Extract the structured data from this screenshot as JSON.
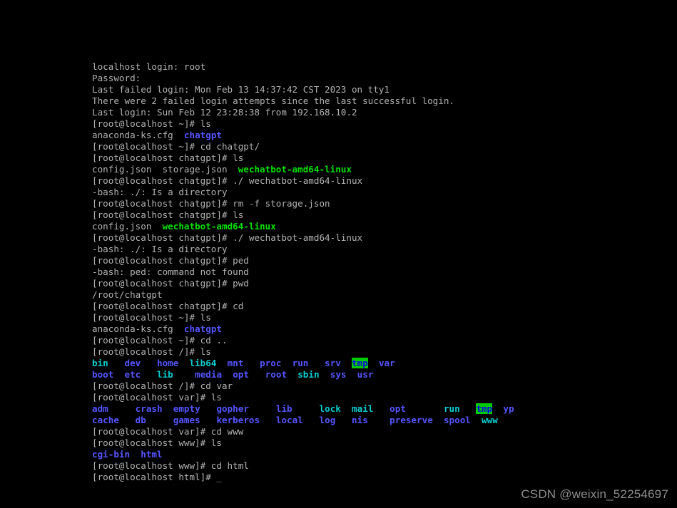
{
  "terminal": {
    "theme": {
      "background": "#000000",
      "foreground": "#b2b2b2",
      "directory": "#5555ff",
      "symlink": "#00cdcd",
      "executable": "#00e000",
      "sticky_bg": "#00cd00",
      "sticky_fg": "#0000ee"
    },
    "hostname": "localhost",
    "user": "root",
    "cursor": "_",
    "lines": [
      {
        "id": "login-prompt",
        "segments": [
          {
            "text": "localhost login: root",
            "style": "default"
          }
        ]
      },
      {
        "id": "password-prompt",
        "segments": [
          {
            "text": "Password:",
            "style": "default"
          }
        ]
      },
      {
        "id": "last-failed-login",
        "segments": [
          {
            "text": "Last failed login: Mon Feb 13 14:37:42 CST 2023 on tty1",
            "style": "default"
          }
        ]
      },
      {
        "id": "failed-attempts",
        "segments": [
          {
            "text": "There were 2 failed login attempts since the last successful login.",
            "style": "default"
          }
        ]
      },
      {
        "id": "last-login",
        "segments": [
          {
            "text": "Last login: Sun Feb 12 23:28:38 from 192.168.10.2",
            "style": "default"
          }
        ]
      },
      {
        "id": "cmd-ls-home",
        "segments": [
          {
            "text": "[root@localhost ~]# ls",
            "style": "default"
          }
        ]
      },
      {
        "id": "out-ls-home",
        "segments": [
          {
            "text": "anaconda-ks.cfg  ",
            "style": "default"
          },
          {
            "text": "chatgpt",
            "style": "dir"
          }
        ]
      },
      {
        "id": "cmd-cd-chatgpt",
        "segments": [
          {
            "text": "[root@localhost ~]# cd chatgpt/",
            "style": "default"
          }
        ]
      },
      {
        "id": "cmd-ls-chatgpt-1",
        "segments": [
          {
            "text": "[root@localhost chatgpt]# ls",
            "style": "default"
          }
        ]
      },
      {
        "id": "out-ls-chatgpt-1",
        "segments": [
          {
            "text": "config.json  storage.json  ",
            "style": "default"
          },
          {
            "text": "wechatbot-amd64-linux",
            "style": "exec"
          }
        ]
      },
      {
        "id": "cmd-run-bot-1",
        "segments": [
          {
            "text": "[root@localhost chatgpt]# ./ wechatbot-amd64-linux",
            "style": "default"
          }
        ]
      },
      {
        "id": "err-isdir-1",
        "segments": [
          {
            "text": "-bash: ./: Is a directory",
            "style": "default"
          }
        ]
      },
      {
        "id": "cmd-rm-storage",
        "segments": [
          {
            "text": "[root@localhost chatgpt]# rm -f storage.json",
            "style": "default"
          }
        ]
      },
      {
        "id": "cmd-ls-chatgpt-2",
        "segments": [
          {
            "text": "[root@localhost chatgpt]# ls",
            "style": "default"
          }
        ]
      },
      {
        "id": "out-ls-chatgpt-2",
        "segments": [
          {
            "text": "config.json  ",
            "style": "default"
          },
          {
            "text": "wechatbot-amd64-linux",
            "style": "exec"
          }
        ]
      },
      {
        "id": "cmd-run-bot-2",
        "segments": [
          {
            "text": "[root@localhost chatgpt]# ./ wechatbot-amd64-linux",
            "style": "default"
          }
        ]
      },
      {
        "id": "err-isdir-2",
        "segments": [
          {
            "text": "-bash: ./: Is a directory",
            "style": "default"
          }
        ]
      },
      {
        "id": "cmd-ped",
        "segments": [
          {
            "text": "[root@localhost chatgpt]# ped",
            "style": "default"
          }
        ]
      },
      {
        "id": "err-ped",
        "segments": [
          {
            "text": "-bash: ped: command not found",
            "style": "default"
          }
        ]
      },
      {
        "id": "cmd-pwd",
        "segments": [
          {
            "text": "[root@localhost chatgpt]# pwd",
            "style": "default"
          }
        ]
      },
      {
        "id": "out-pwd",
        "segments": [
          {
            "text": "/root/chatgpt",
            "style": "default"
          }
        ]
      },
      {
        "id": "cmd-cd-home",
        "segments": [
          {
            "text": "[root@localhost chatgpt]# cd",
            "style": "default"
          }
        ]
      },
      {
        "id": "cmd-ls-home-2",
        "segments": [
          {
            "text": "[root@localhost ~]# ls",
            "style": "default"
          }
        ]
      },
      {
        "id": "out-ls-home-2",
        "segments": [
          {
            "text": "anaconda-ks.cfg  ",
            "style": "default"
          },
          {
            "text": "chatgpt",
            "style": "dir"
          }
        ]
      },
      {
        "id": "cmd-cd-up",
        "segments": [
          {
            "text": "[root@localhost ~]# cd ..",
            "style": "default"
          }
        ]
      },
      {
        "id": "cmd-ls-root",
        "segments": [
          {
            "text": "[root@localhost /]# ls",
            "style": "default"
          }
        ]
      },
      {
        "id": "out-ls-root-1",
        "segments": [
          {
            "text": "bin",
            "style": "link"
          },
          {
            "text": "   ",
            "style": "default"
          },
          {
            "text": "dev",
            "style": "dir"
          },
          {
            "text": "   ",
            "style": "default"
          },
          {
            "text": "home",
            "style": "dir"
          },
          {
            "text": "  ",
            "style": "default"
          },
          {
            "text": "lib64",
            "style": "link"
          },
          {
            "text": "  ",
            "style": "default"
          },
          {
            "text": "mnt",
            "style": "dir"
          },
          {
            "text": "   ",
            "style": "default"
          },
          {
            "text": "proc",
            "style": "dir"
          },
          {
            "text": "  ",
            "style": "default"
          },
          {
            "text": "run",
            "style": "dir"
          },
          {
            "text": "   ",
            "style": "default"
          },
          {
            "text": "srv",
            "style": "dir"
          },
          {
            "text": "  ",
            "style": "default"
          },
          {
            "text": "tmp",
            "style": "sticky"
          },
          {
            "text": "  ",
            "style": "default"
          },
          {
            "text": "var",
            "style": "dir"
          }
        ]
      },
      {
        "id": "out-ls-root-2",
        "segments": [
          {
            "text": "boot",
            "style": "dir"
          },
          {
            "text": "  ",
            "style": "default"
          },
          {
            "text": "etc",
            "style": "dir"
          },
          {
            "text": "   ",
            "style": "default"
          },
          {
            "text": "lib",
            "style": "link"
          },
          {
            "text": "    ",
            "style": "default"
          },
          {
            "text": "media",
            "style": "dir"
          },
          {
            "text": "  ",
            "style": "default"
          },
          {
            "text": "opt",
            "style": "dir"
          },
          {
            "text": "   ",
            "style": "default"
          },
          {
            "text": "root",
            "style": "dir"
          },
          {
            "text": "  ",
            "style": "default"
          },
          {
            "text": "sbin",
            "style": "link"
          },
          {
            "text": "  ",
            "style": "default"
          },
          {
            "text": "sys",
            "style": "dir"
          },
          {
            "text": "  ",
            "style": "default"
          },
          {
            "text": "usr",
            "style": "dir"
          }
        ]
      },
      {
        "id": "cmd-cd-var",
        "segments": [
          {
            "text": "[root@localhost /]# cd var",
            "style": "default"
          }
        ]
      },
      {
        "id": "cmd-ls-var",
        "segments": [
          {
            "text": "[root@localhost var]# ls",
            "style": "default"
          }
        ]
      },
      {
        "id": "out-ls-var-1",
        "segments": [
          {
            "text": "adm",
            "style": "dir"
          },
          {
            "text": "     ",
            "style": "default"
          },
          {
            "text": "crash",
            "style": "dir"
          },
          {
            "text": "  ",
            "style": "default"
          },
          {
            "text": "empty",
            "style": "dir"
          },
          {
            "text": "   ",
            "style": "default"
          },
          {
            "text": "gopher",
            "style": "dir"
          },
          {
            "text": "     ",
            "style": "default"
          },
          {
            "text": "lib",
            "style": "dir"
          },
          {
            "text": "     ",
            "style": "default"
          },
          {
            "text": "lock",
            "style": "link"
          },
          {
            "text": "  ",
            "style": "default"
          },
          {
            "text": "mail",
            "style": "link"
          },
          {
            "text": "   ",
            "style": "default"
          },
          {
            "text": "opt",
            "style": "dir"
          },
          {
            "text": "       ",
            "style": "default"
          },
          {
            "text": "run",
            "style": "link"
          },
          {
            "text": "   ",
            "style": "default"
          },
          {
            "text": "tmp",
            "style": "sticky"
          },
          {
            "text": "  ",
            "style": "default"
          },
          {
            "text": "yp",
            "style": "dir"
          }
        ]
      },
      {
        "id": "out-ls-var-2",
        "segments": [
          {
            "text": "cache",
            "style": "dir"
          },
          {
            "text": "   ",
            "style": "default"
          },
          {
            "text": "db",
            "style": "dir"
          },
          {
            "text": "     ",
            "style": "default"
          },
          {
            "text": "games",
            "style": "dir"
          },
          {
            "text": "   ",
            "style": "default"
          },
          {
            "text": "kerberos",
            "style": "dir"
          },
          {
            "text": "   ",
            "style": "default"
          },
          {
            "text": "local",
            "style": "dir"
          },
          {
            "text": "   ",
            "style": "default"
          },
          {
            "text": "log",
            "style": "dir"
          },
          {
            "text": "   ",
            "style": "default"
          },
          {
            "text": "nis",
            "style": "dir"
          },
          {
            "text": "    ",
            "style": "default"
          },
          {
            "text": "preserve",
            "style": "dir"
          },
          {
            "text": "  ",
            "style": "default"
          },
          {
            "text": "spool",
            "style": "dir"
          },
          {
            "text": "  ",
            "style": "default"
          },
          {
            "text": "www",
            "style": "link"
          }
        ]
      },
      {
        "id": "cmd-cd-www",
        "segments": [
          {
            "text": "[root@localhost var]# cd www",
            "style": "default"
          }
        ]
      },
      {
        "id": "cmd-ls-www",
        "segments": [
          {
            "text": "[root@localhost www]# ls",
            "style": "default"
          }
        ]
      },
      {
        "id": "out-ls-www",
        "segments": [
          {
            "text": "cgi-bin",
            "style": "dir"
          },
          {
            "text": "  ",
            "style": "default"
          },
          {
            "text": "html",
            "style": "dir"
          }
        ]
      },
      {
        "id": "cmd-cd-html",
        "segments": [
          {
            "text": "[root@localhost www]# cd html",
            "style": "default"
          }
        ]
      },
      {
        "id": "prompt-current",
        "segments": [
          {
            "text": "[root@localhost html]# ",
            "style": "default"
          },
          {
            "text": "_",
            "style": "cursor"
          }
        ]
      }
    ]
  },
  "watermark": {
    "text": "CSDN @weixin_52254697"
  }
}
